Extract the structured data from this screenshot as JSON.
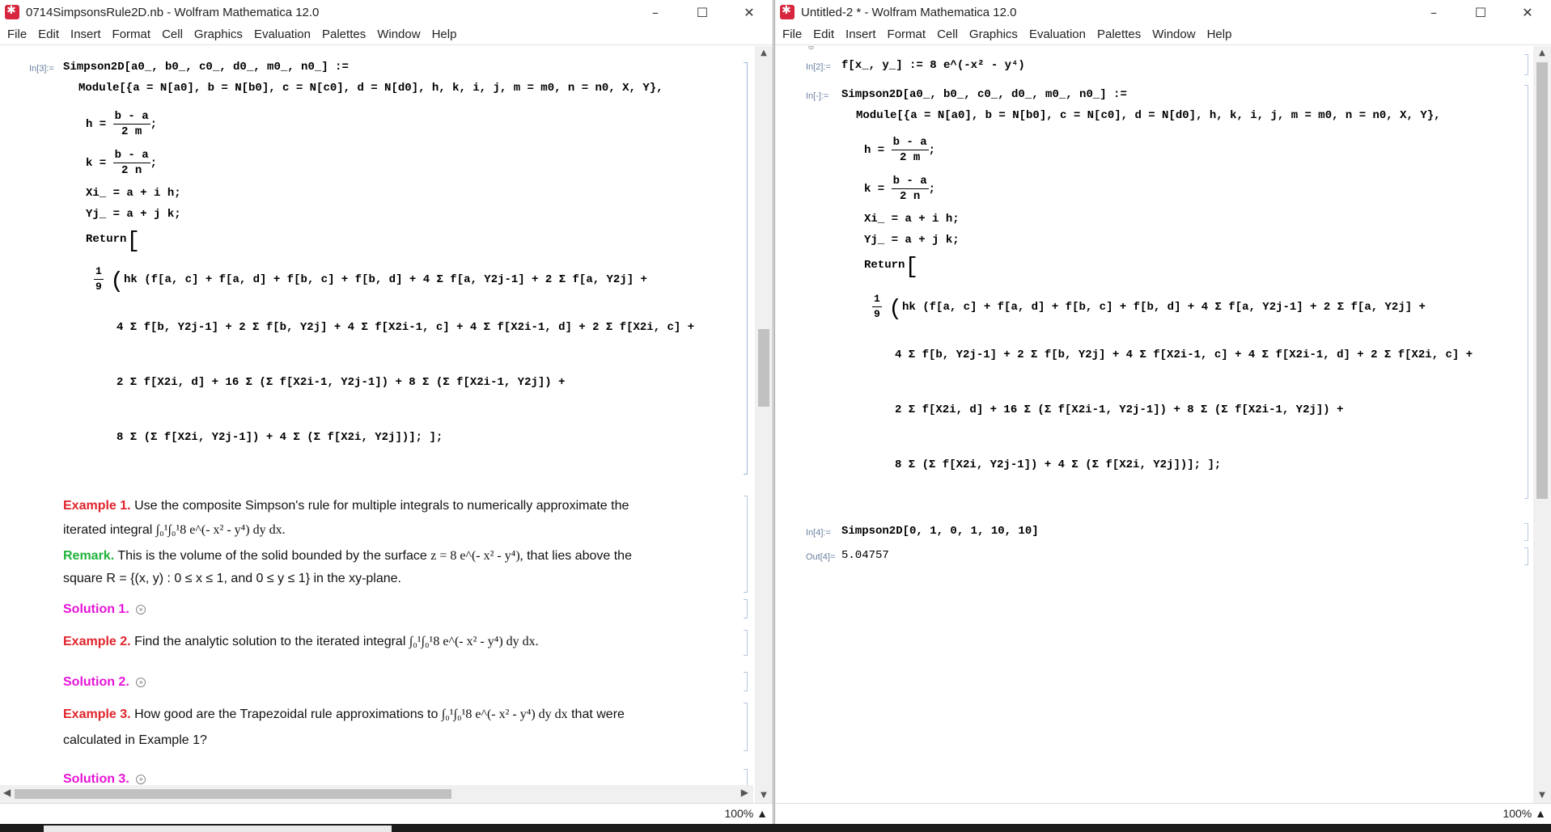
{
  "left_window": {
    "title": "0714SimpsonsRule2D.nb - Wolfram Mathematica 12.0",
    "zoom": "100%",
    "input_label": "In[3]:=",
    "def_line1": "Simpson2D[a0_, b0_, c0_, d0_, m0_, n0_] :=",
    "module_line": "Module[{a = N[a0], b = N[b0], c = N[c0], d = N[d0], h, k, i, j, m = m0, n = n0, X, Y},",
    "h_lhs": "h =",
    "h_num": "b - a",
    "h_den": "2 m",
    "k_lhs": "k =",
    "k_num": "b - a",
    "k_den": "2 n",
    "x_line": "Xi_ = a + i h;",
    "y_line": "Yj_ = a + j k;",
    "return_kw": "Return",
    "f1": "hk (f[a, c] + f[a, d] + f[b, c] + f[b, d] + 4 Σ f[a, Y2j-1] + 2 Σ f[a, Y2j] +",
    "f2": "4 Σ f[b, Y2j-1] + 2 Σ f[b, Y2j] + 4 Σ f[X2i-1, c] + 4 Σ f[X2i-1, d] + 2 Σ f[X2i, c] +",
    "f3": "2 Σ f[X2i, d] + 16 Σ (Σ f[X2i-1, Y2j-1]) + 8 Σ (Σ f[X2i-1, Y2j]) +",
    "f4": "8 Σ (Σ f[X2i, Y2j-1]) + 4 Σ (Σ f[X2i, Y2j])]; ];",
    "ex1_label": "Example 1.",
    "ex1_text": "Use the composite Simpson's rule for multiple integrals to numerically approximate the",
    "ex1_text2": "iterated integral",
    "ex1_integral": "∫₀¹∫₀¹8 e^(- x² - y⁴) dy dx.",
    "remark_label": "Remark.",
    "remark_text": "This is the volume of the solid bounded by the surface",
    "remark_surface": "z = 8 e^(- x² - y⁴),",
    "remark_text_b": "that lies above the",
    "remark_text2": "square R = {(x, y) : 0 ≤ x ≤ 1, and 0 ≤ y ≤ 1} in the xy-plane.",
    "sol1": "Solution 1.",
    "ex2_label": "Example 2.",
    "ex2_text": "Find the analytic solution to the iterated integral",
    "ex2_integral": "∫₀¹∫₀¹8 e^(- x² - y⁴) dy dx.",
    "sol2": "Solution 2.",
    "ex3_label": "Example 3.",
    "ex3_text": "How good are the Trapezoidal rule approximations to",
    "ex3_integral": "∫₀¹∫₀¹8 e^(- x² - y⁴) dy dx",
    "ex3_text_b": "that were",
    "ex3_text2": "calculated in Example 1?",
    "sol3": "Solution 3."
  },
  "right_window": {
    "title": "Untitled-2 * - Wolfram Mathematica 12.0",
    "zoom": "100%",
    "in2_label": "In[2]:=",
    "in2_code": "f[x_, y_] := 8 e^(-x² - y⁴)",
    "in_blank_label": "In[-]:=",
    "in4_label": "In[4]:=",
    "in4_code": "Simpson2D[0, 1, 0, 1, 10, 10]",
    "out4_label": "Out[4]=",
    "out4_value": "5.04757"
  },
  "menu": [
    "File",
    "Edit",
    "Insert",
    "Format",
    "Cell",
    "Graphics",
    "Evaluation",
    "Palettes",
    "Window",
    "Help"
  ],
  "colors": {
    "example": "#e0242c",
    "remark": "#21b33b",
    "solution": "#e613d6",
    "app_icon": "#d7263d"
  }
}
